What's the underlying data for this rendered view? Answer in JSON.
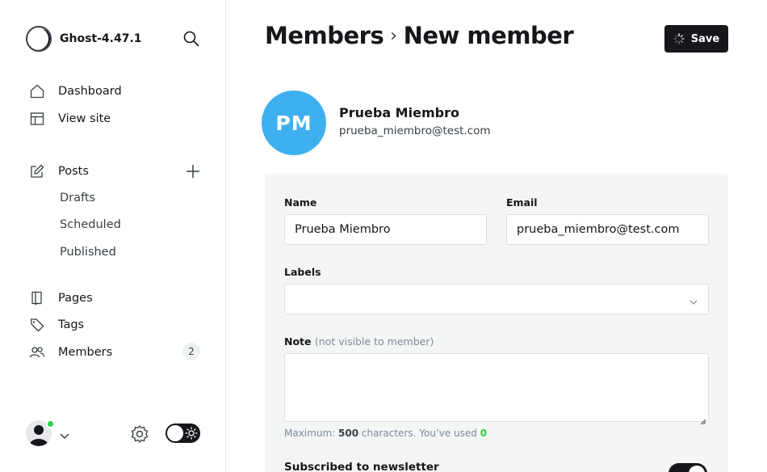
{
  "app": {
    "name": "Ghost-4.47.1"
  },
  "sidebar": {
    "primary": [
      {
        "label": "Dashboard",
        "icon": "house-icon"
      },
      {
        "label": "View site",
        "icon": "layout-icon"
      }
    ],
    "posts": {
      "label": "Posts",
      "icon": "pencil-square-icon",
      "subitems": [
        "Drafts",
        "Scheduled",
        "Published"
      ]
    },
    "secondary": [
      {
        "label": "Pages",
        "icon": "page-icon"
      },
      {
        "label": "Tags",
        "icon": "tag-icon"
      },
      {
        "label": "Members",
        "icon": "members-icon",
        "count": "2"
      }
    ]
  },
  "header": {
    "breadcrumb_parent": "Members",
    "breadcrumb_separator": "›",
    "title": "New member",
    "save_label": "Save"
  },
  "member": {
    "initials": "PM",
    "name": "Prueba Miembro",
    "email": "prueba_miembro@test.com",
    "avatar_color": "#3eb0ef"
  },
  "form": {
    "name_label": "Name",
    "name_value": "Prueba Miembro",
    "email_label": "Email",
    "email_value": "prueba_miembro@test.com",
    "labels_label": "Labels",
    "labels_value": "",
    "note_label": "Note",
    "note_hint": "(not visible to member)",
    "note_value": "",
    "counter_prefix": "Maximum:",
    "counter_max": "500",
    "counter_middle": "characters. You’ve used",
    "counter_used": "0",
    "newsletter_label": "Subscribed to newsletter",
    "newsletter_on": true
  },
  "colors": {
    "accent": "#15171a",
    "online": "#30cf43",
    "avatar": "#3eb0ef"
  }
}
